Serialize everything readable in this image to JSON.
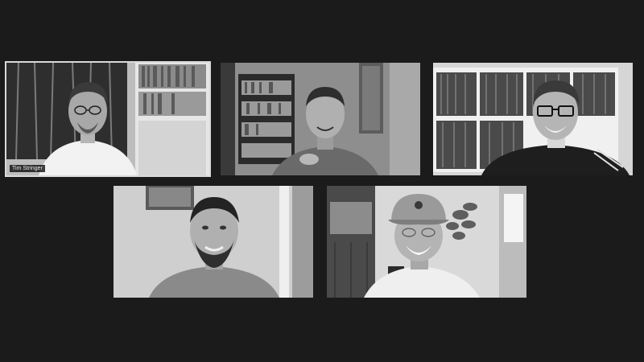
{
  "call": {
    "participants": [
      {
        "name_label": "Tim Stringer",
        "active_speaker": true
      },
      {
        "name_label": "",
        "active_speaker": false
      },
      {
        "name_label": "",
        "active_speaker": false
      },
      {
        "name_label": "",
        "active_speaker": false
      },
      {
        "name_label": "",
        "active_speaker": false
      }
    ]
  },
  "colors": {
    "background": "#1b1b1b",
    "active_border": "#d9d9d9",
    "name_tag_bg": "#000000",
    "name_tag_text": "#e8e8e8"
  }
}
